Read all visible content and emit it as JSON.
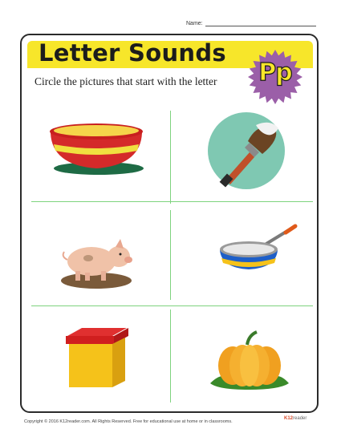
{
  "header": {
    "name_label": "Name:"
  },
  "banner": {
    "title": "Letter Sounds"
  },
  "instruction": "Circle the pictures that start with the letter",
  "badge": {
    "letters": "Pp",
    "color": "#9b5fa8"
  },
  "pictures": [
    {
      "name": "bowl-icon"
    },
    {
      "name": "paintbrush-icon"
    },
    {
      "name": "pig-icon"
    },
    {
      "name": "pan-icon"
    },
    {
      "name": "box-icon"
    },
    {
      "name": "pumpkin-icon"
    }
  ],
  "footer": {
    "copyright": "Copyright © 2016  K12reader.com. All Rights Reserved. Free for educational use at home or in classrooms."
  },
  "logo": {
    "k": "K12",
    "rest": "reader"
  },
  "colors": {
    "banner": "#f7e62a",
    "divider": "#7ed37e",
    "frame": "#2b2b2b"
  }
}
